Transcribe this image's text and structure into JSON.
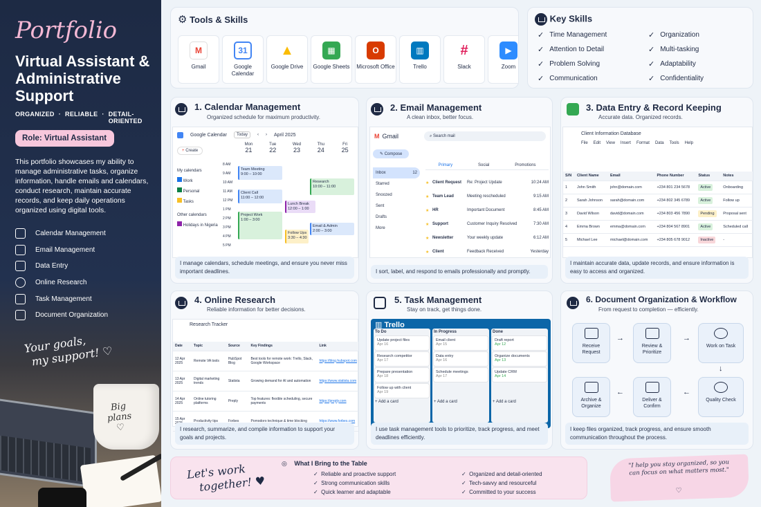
{
  "sidebar": {
    "script_title": "Portfolio",
    "title": "Virtual Assistant & Administrative Support",
    "tags": [
      "ORGANIZED",
      "·",
      "RELIABLE",
      "·",
      "DETAIL-ORIENTED"
    ],
    "role": "Role: Virtual Assistant",
    "intro": "This portfolio showcases my ability to manage administrative tasks, organize information, handle emails and calendars, conduct research, maintain accurate records, and keep daily operations organized using digital tools.",
    "items": [
      {
        "label": "Calendar Management",
        "icon": "calendar-icon"
      },
      {
        "label": "Email Management",
        "icon": "mail-icon"
      },
      {
        "label": "Data Entry",
        "icon": "document-icon"
      },
      {
        "label": "Online Research",
        "icon": "globe-icon"
      },
      {
        "label": "Task Management",
        "icon": "checkbox-icon"
      },
      {
        "label": "Document Organization",
        "icon": "file-icon"
      }
    ],
    "goals_line1": "Your goals,",
    "goals_line2": "my support! ♡",
    "mug_line1": "Big",
    "mug_line2": "plans",
    "mug_line3": "♡"
  },
  "tools": {
    "title": "Tools & Skills",
    "apps": [
      {
        "name": "Gmail",
        "color": "#ea4335",
        "glyph": "M"
      },
      {
        "name": "Google Calendar",
        "color": "#4285f4",
        "glyph": "31"
      },
      {
        "name": "Google Drive",
        "color": "#fbbc05",
        "glyph": "▲"
      },
      {
        "name": "Google Sheets",
        "color": "#34a853",
        "glyph": "▦"
      },
      {
        "name": "Microsoft Office",
        "color": "#d83b01",
        "glyph": "O"
      },
      {
        "name": "Trello",
        "color": "#0079bf",
        "glyph": "▥"
      },
      {
        "name": "Slack",
        "color": "#e01e5a",
        "glyph": "#"
      },
      {
        "name": "Zoom",
        "color": "#2d8cff",
        "glyph": "▶"
      }
    ]
  },
  "keyskills": {
    "title": "Key Skills",
    "left": [
      "Time Management",
      "Attention to Detail",
      "Problem Solving",
      "Communication"
    ],
    "right": [
      "Organization",
      "Multi-tasking",
      "Adaptability",
      "Confidentiality"
    ]
  },
  "calendar": {
    "num": "1.",
    "title": "Calendar Management",
    "sub": "Organized schedule for maximum productivity.",
    "app": "Google Calendar",
    "today": "Today",
    "month": "April 2025",
    "create": "Create",
    "days": [
      {
        "d": "Mon",
        "n": "21"
      },
      {
        "d": "Tue",
        "n": "22"
      },
      {
        "d": "Wed",
        "n": "23"
      },
      {
        "d": "Thu",
        "n": "24"
      },
      {
        "d": "Fri",
        "n": "25"
      }
    ],
    "hours": [
      "8 AM",
      "9 AM",
      "10 AM",
      "11 AM",
      "12 PM",
      "1 PM",
      "2 PM",
      "3 PM",
      "4 PM",
      "5 PM"
    ],
    "my_cals": "My calendars",
    "cals": [
      "Work",
      "Personal",
      "Tasks"
    ],
    "other": "Other calendars",
    "other_item": "Holidays in Nigeria",
    "events": [
      {
        "t": "Team Meeting",
        "h": "9:00 – 10:00"
      },
      {
        "t": "Research",
        "h": "10:00 – 11:00"
      },
      {
        "t": "Client Call",
        "h": "11:00 – 12:00"
      },
      {
        "t": "Lunch Break",
        "h": "12:00 – 1:00"
      },
      {
        "t": "Project Work",
        "h": "1:00 – 3:00"
      },
      {
        "t": "Email & Admin",
        "h": "2:00 – 3:00"
      },
      {
        "t": "Follow Ups",
        "h": "3:30 – 4:30"
      }
    ],
    "caption": "I manage calendars, schedule meetings, and ensure you never miss important deadlines."
  },
  "email": {
    "num": "2.",
    "title": "Email Management",
    "sub": "A clean inbox, better focus.",
    "app": "Gmail",
    "search": "Search mail",
    "compose": "Compose",
    "folders": [
      {
        "n": "Inbox",
        "c": "12"
      },
      {
        "n": "Starred",
        "c": ""
      },
      {
        "n": "Snoozed",
        "c": ""
      },
      {
        "n": "Sent",
        "c": ""
      },
      {
        "n": "Drafts",
        "c": ""
      },
      {
        "n": "More",
        "c": ""
      }
    ],
    "tabs": [
      "Primary",
      "Social",
      "Promotions"
    ],
    "rows": [
      {
        "f": "Client Request",
        "s": "Re: Project Update",
        "t": "10:24 AM"
      },
      {
        "f": "Team Lead",
        "s": "Meeting rescheduled",
        "t": "9:15 AM"
      },
      {
        "f": "HR",
        "s": "Important Document",
        "t": "8:45 AM"
      },
      {
        "f": "Support",
        "s": "Customer Inquiry Resolved",
        "t": "7:30 AM"
      },
      {
        "f": "Newsletter",
        "s": "Your weekly update",
        "t": "6:12 AM"
      },
      {
        "f": "Client",
        "s": "Feedback Received",
        "t": "Yesterday"
      }
    ],
    "caption": "I sort, label, and respond to emails professionally and promptly."
  },
  "data": {
    "num": "3.",
    "title": "Data Entry & Record Keeping",
    "sub": "Accurate data. Organized records.",
    "file": "Client Information Database",
    "menu": [
      "File",
      "Edit",
      "View",
      "Insert",
      "Format",
      "Data",
      "Tools",
      "Help"
    ],
    "cols": [
      "S/N",
      "Client Name",
      "Email",
      "Phone Number",
      "Status",
      "Notes"
    ],
    "rows": [
      [
        "1",
        "John Smith",
        "john@domain.com",
        "+234 801 234 5678",
        "Active",
        "Onboarding"
      ],
      [
        "2",
        "Sarah Johnson",
        "sarah@domain.com",
        "+234 802 345 6789",
        "Active",
        "Follow up"
      ],
      [
        "3",
        "David Wilson",
        "david@domain.com",
        "+234 803 456 7890",
        "Pending",
        "Proposal sent"
      ],
      [
        "4",
        "Emma Brown",
        "emma@domain.com",
        "+234 804 567 8901",
        "Active",
        "Scheduled call"
      ],
      [
        "5",
        "Michael Lee",
        "michael@domain.com",
        "+234 805 678 9012",
        "Inactive",
        "-"
      ]
    ],
    "caption": "I maintain accurate data, update records, and ensure information is easy to access and organized."
  },
  "research": {
    "num": "4.",
    "title": "Online Research",
    "sub": "Reliable information for better decisions.",
    "file": "Research Tracker",
    "cols": [
      "Date",
      "Topic",
      "Source",
      "Key Findings",
      "Link"
    ],
    "rows": [
      [
        "12 Apr 2025",
        "Remote VA tools",
        "HubSpot Blog",
        "Best tools for remote work: Trello, Slack, Google Workspace",
        "https://blog.hubspot.com"
      ],
      [
        "13 Apr 2025",
        "Digital marketing trends",
        "Statista",
        "Growing demand for AI and automation",
        "https://www.statista.com"
      ],
      [
        "14 Apr 2025",
        "Online tutoring platforms",
        "Preply",
        "Top features: flexible scheduling, secure payments",
        "https://preply.com"
      ],
      [
        "15 Apr 2025",
        "Productivity tips",
        "Forbes",
        "Pomodoro technique & time blocking",
        "https://www.forbes.com"
      ]
    ],
    "caption": "I research, summarize, and compile information to support your goals and projects."
  },
  "tasks": {
    "num": "5.",
    "title": "Task Management",
    "sub": "Stay on track, get things done.",
    "app": "Trello",
    "cols": [
      {
        "n": "To Do",
        "cards": [
          "Update project files",
          "Research competitor",
          "Prepare presentation",
          "Follow up with client"
        ]
      },
      {
        "n": "In Progress",
        "cards": [
          "Email client",
          "Data entry",
          "Schedule meetings"
        ]
      },
      {
        "n": "Done",
        "cards": [
          "Draft report",
          "Organize documents",
          "Update CRM"
        ]
      }
    ],
    "dates": [
      "Apr 16",
      "Apr 17",
      "Apr 18",
      "Apr 19",
      "Apr 15",
      "Apr 16",
      "Apr 17",
      "Apr 12",
      "Apr 13",
      "Apr 14"
    ],
    "add": "+ Add a card",
    "caption": "I use task management tools to prioritize, track progress, and meet deadlines efficiently."
  },
  "docs": {
    "num": "6.",
    "title": "Document Organization & Workflow",
    "sub": "From request to completion — efficiently.",
    "steps": [
      "Receive Request",
      "Review & Prioritize",
      "Work on Task",
      "Quality Check",
      "Deliver & Confirm",
      "Archive & Organize"
    ],
    "caption": "I keep files organized, track progress, and ensure smooth communication throughout the process."
  },
  "footer": {
    "lets": "Let's work",
    "together": "together! ♥",
    "bring": "What I Bring to the Table",
    "left": [
      "Reliable and proactive support",
      "Strong communication skills",
      "Quick learner and adaptable"
    ],
    "right": [
      "Organized and detail-oriented",
      "Tech-savvy and resourceful",
      "Committed to your success"
    ],
    "quote": "\"I help you stay organized, so you can focus on what matters most.\"",
    "heart": "♡"
  }
}
